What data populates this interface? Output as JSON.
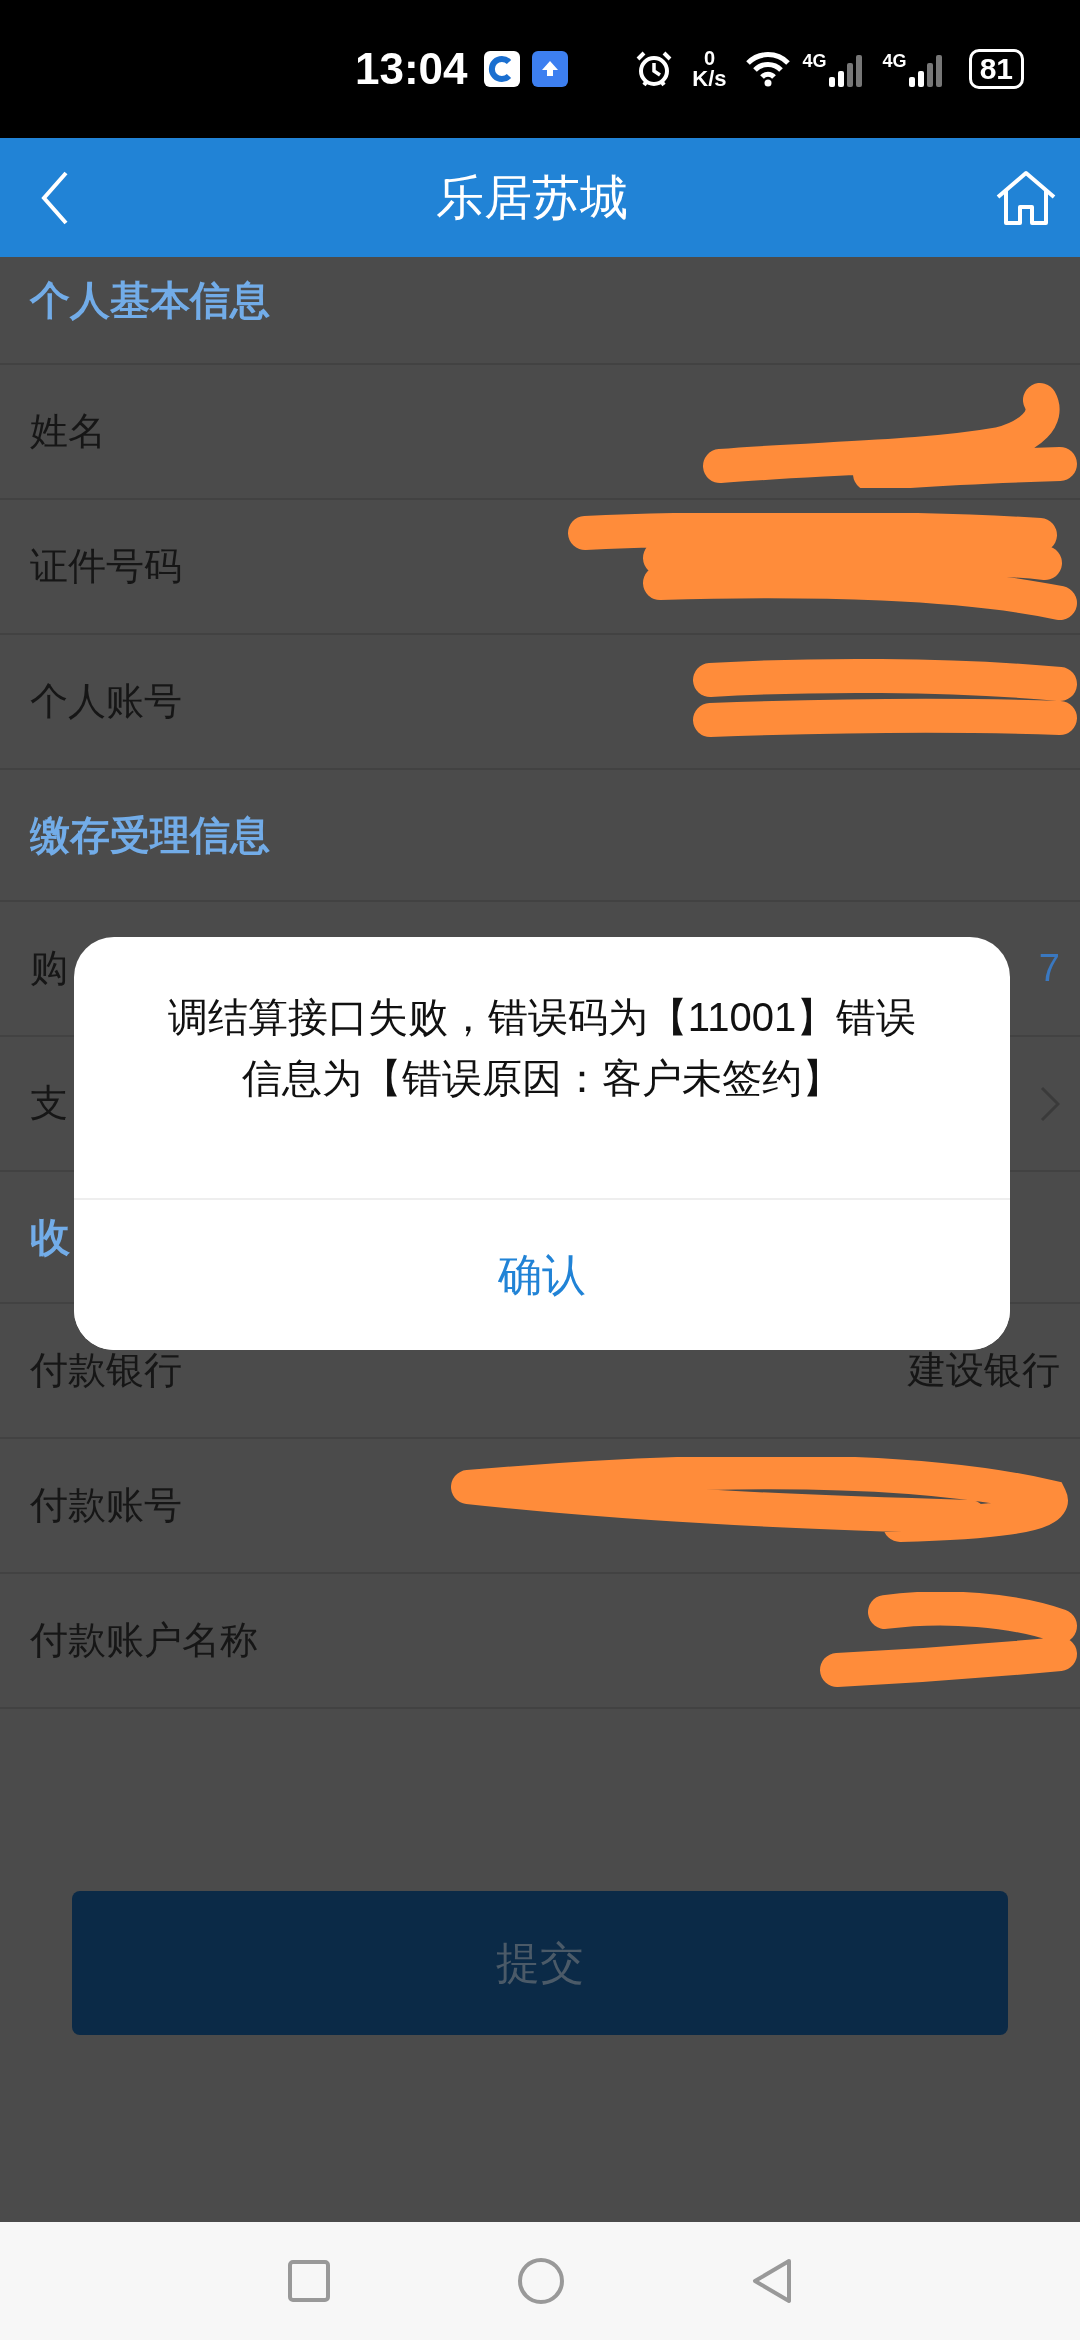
{
  "status_bar": {
    "time": "13:04",
    "net_speed_value": "0",
    "net_speed_unit": "K/s",
    "signal_labels": [
      "4G",
      "4G"
    ],
    "battery": "81"
  },
  "header": {
    "title": "乐居苏城"
  },
  "sections": [
    {
      "title": "个人基本信息",
      "rows": [
        {
          "label": "姓名",
          "redacted": true
        },
        {
          "label": "证件号码",
          "redacted": true
        },
        {
          "label": "个人账号",
          "redacted": true
        }
      ]
    },
    {
      "title": "缴存受理信息",
      "rows": [
        {
          "label": "购",
          "value": "7",
          "accent": true
        },
        {
          "label": "支",
          "chevron": true
        }
      ]
    },
    {
      "title": "收",
      "rows": [
        {
          "label": "付款银行",
          "value": "建设银行"
        },
        {
          "label": "付款账号",
          "redacted": true
        },
        {
          "label": "付款账户名称",
          "redacted": true
        }
      ]
    }
  ],
  "submit_button": {
    "label": "提交",
    "disabled": true
  },
  "dialog": {
    "message": "调结算接口失败，错误码为【11001】错误信息为【错误原因：客户未签约】",
    "confirm": "确认"
  }
}
